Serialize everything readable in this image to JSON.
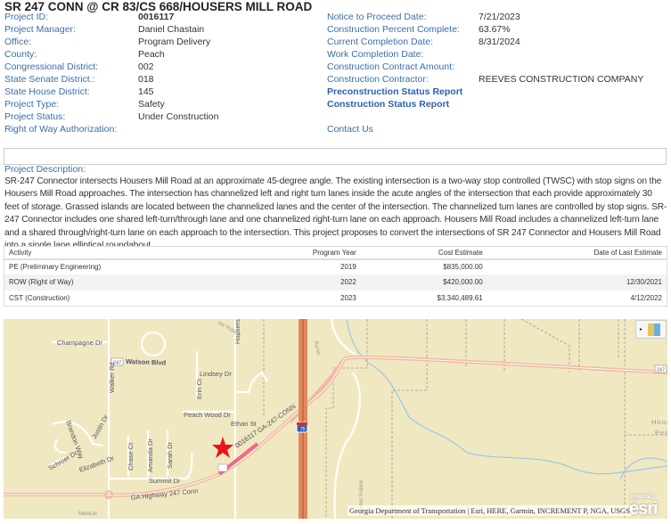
{
  "title": "SR 247 CONN @ CR 83/CS 668/HOUSERS MILL ROAD",
  "left_fields": [
    {
      "label": "Project ID:",
      "value": "0016117"
    },
    {
      "label": "Project Manager:",
      "value": "Daniel Chastain"
    },
    {
      "label": "Office:",
      "value": "Program Delivery"
    },
    {
      "label": "County:",
      "value": "Peach"
    },
    {
      "label": "Congressional District:",
      "value": "002"
    },
    {
      "label": "State Senate District.:",
      "value": "018"
    },
    {
      "label": "State House District:",
      "value": "145"
    },
    {
      "label": "Project Type:",
      "value": "Safety"
    },
    {
      "label": "Project Status:",
      "value": "Under Construction"
    },
    {
      "label": "Right of Way Authorization:",
      "value": ""
    }
  ],
  "right_fields": [
    {
      "label": "Notice to Proceed Date:",
      "value": "7/21/2023"
    },
    {
      "label": "Construction Percent Complete:",
      "value": "63.67%"
    },
    {
      "label": "Current Completion Date:",
      "value": "8/31/2024"
    },
    {
      "label": "Work Completion Date:",
      "value": ""
    },
    {
      "label": "Construction Contract Amount:",
      "value": ""
    },
    {
      "label": "Construction Contractor:",
      "value": "REEVES CONSTRUCTION COMPANY"
    }
  ],
  "links": {
    "preconstruction": "Preconstruction Status Report",
    "construction": "Construction Status Report",
    "contact": "Contact Us"
  },
  "description": {
    "label": "Project Description:",
    "text": "SR-247 Connector intersects Housers Mill Road at an approximate 45-degree angle. The existing intersection is a two-way stop controlled (TWSC) with stop signs on the Housers Mill Road approaches. The intersection has channelized left and right turn lanes inside the acute angles of the intersection that each provide approximately 30 feet of storage. Grassed islands are located between the channelized lanes and the center of the intersection. The channelized turn lanes are controlled by stop signs. SR-247 Connector includes one shared left-turn/through lane and one channelized right-turn lane on each approach. Housers Mill Road includes a channelized left-turn lane and a shared through/right-turn lane on each approach to the intersection. This project proposes to convert the intersections of SR 247 Connector and Housers Mill Road into a single lane elliptical roundabout."
  },
  "table": {
    "headers": [
      "Activity",
      "Program Year",
      "Cost Estimate",
      "Date of Last Estimate"
    ],
    "rows": [
      [
        "PE (Preliminary Engineering)",
        "2019",
        "$835,000.00",
        ""
      ],
      [
        "ROW (Right of Way)",
        "2022",
        "$420,000.00",
        "12/30/2021"
      ],
      [
        "CST (Construction)",
        "2023",
        "$3,340,489.61",
        "4/12/2022"
      ]
    ]
  },
  "map": {
    "labels": {
      "champagne": "Champagne Dr",
      "walker": "Walker Rd",
      "lindsey": "Lindsey Dr",
      "erin": "Erin Ct",
      "housers": "Housers",
      "peachwood": "Peach Wood Dr",
      "ethan": "Ethan St",
      "justin": "Justin Dr",
      "brandon": "Brandon Way",
      "schroer": "Schroer Dr",
      "elizabeth": "Elizabeth Dr",
      "chase": "Chase Ct",
      "amanda": "Amanda Dr",
      "sarah": "Sarah Dr",
      "summit": "Summit Dr",
      "ga247": "GA Highway 247 Conn",
      "ga247b": "GA-247-CONN",
      "project": "0016117",
      "watson": "Watson Blvd",
      "shield247": "247",
      "i75": "75",
      "byron": "Byron",
      "warner1": "Warner Robins",
      "warner2": "ner Robins",
      "hous": "Hous",
      "pea": "Pea",
      "medical": "Medical"
    },
    "attribution": "Georgia Department of Transportation | Esri, HERE, Garmin, INCREMENT P, NGA, USGS",
    "logo": "esri",
    "logo_sub": "POWERED BY",
    "marker_color": "#e8141c",
    "project_color": "#f06a8a"
  }
}
